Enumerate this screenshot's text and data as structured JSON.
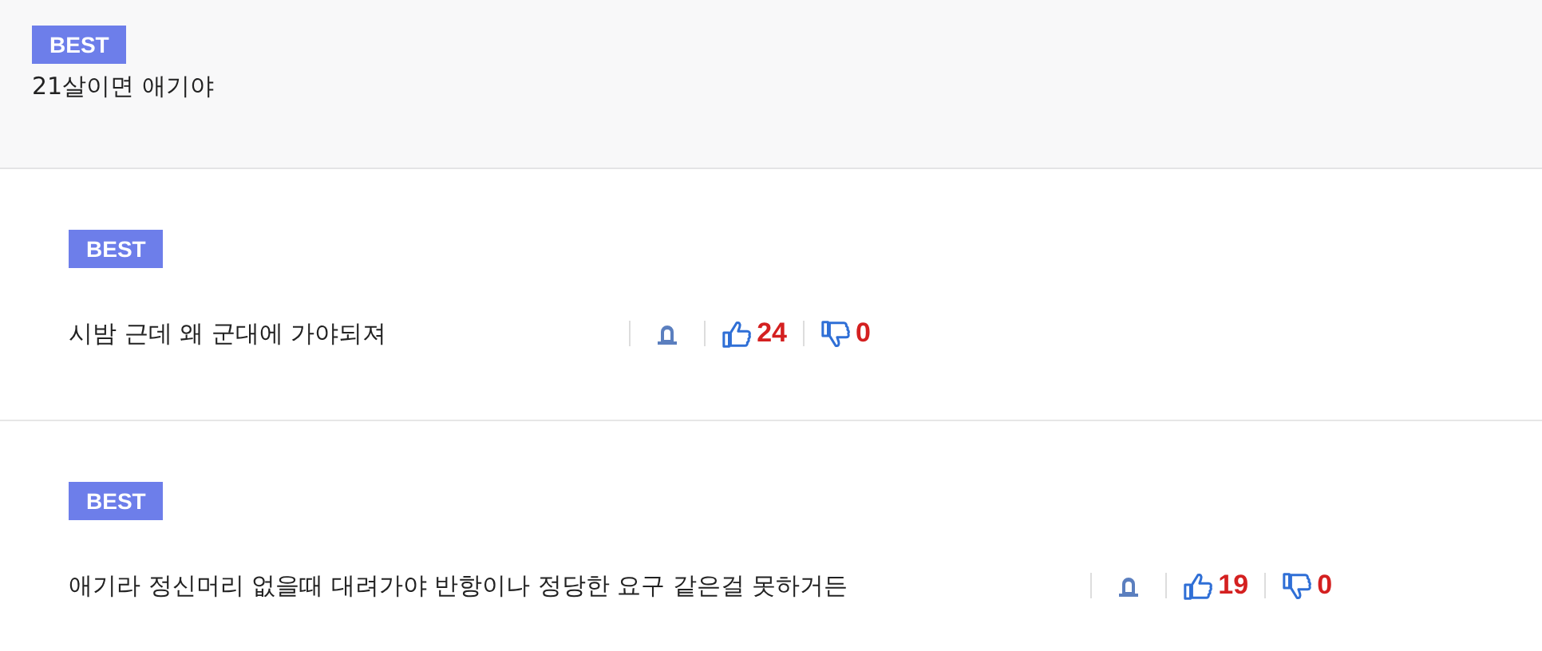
{
  "comments": [
    {
      "kind": "parent",
      "badge": "BEST",
      "text": "21살이면 애기야"
    },
    {
      "kind": "reply",
      "badge": "BEST",
      "text": "시밤 근데 왜 군대에 가야되져",
      "likes": "24",
      "dislikes": "0"
    },
    {
      "kind": "reply",
      "badge": "BEST",
      "text": "애기라 정신머리 없을때 대려가야 반항이나 정당한 요구 같은걸 못하거든",
      "likes": "19",
      "dislikes": "0"
    }
  ]
}
